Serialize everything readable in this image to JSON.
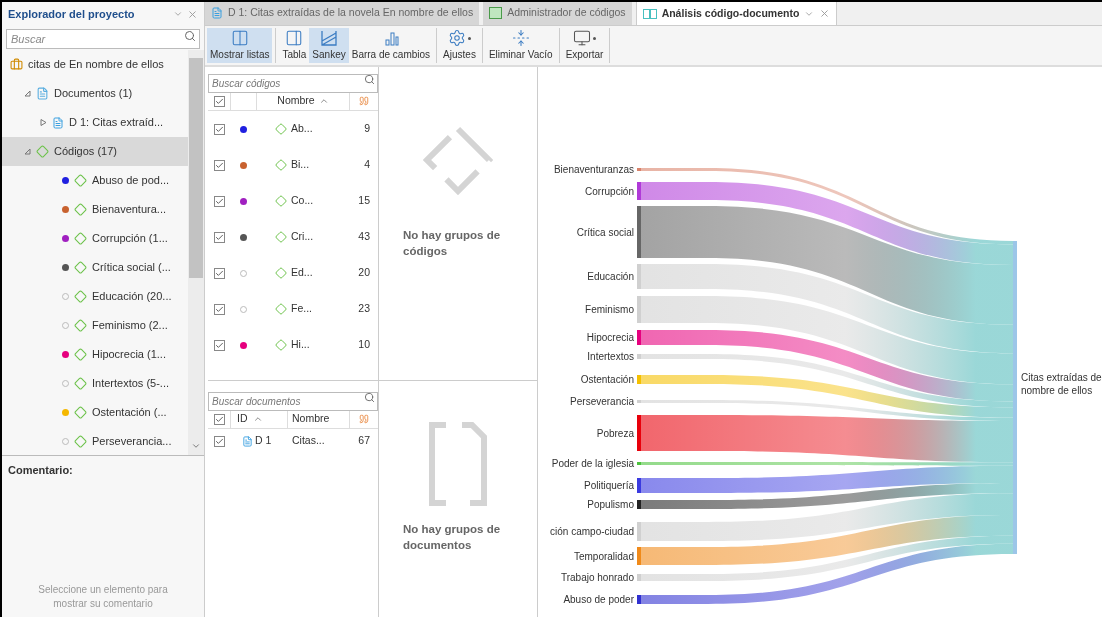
{
  "project_explorer": {
    "title": "Explorador del proyecto",
    "search": {
      "placeholder": "Buscar"
    },
    "tree": [
      {
        "label": "citas de En nombre de ellos",
        "kind": "project",
        "selected": false,
        "children": [
          {
            "label": "Documentos (1)",
            "kind": "documents",
            "expanded": true,
            "selected": false,
            "children": [
              {
                "label": "D 1: Citas extraíd...",
                "kind": "document",
                "expanded": false,
                "selected": false
              }
            ]
          },
          {
            "label": "Códigos (17)",
            "kind": "codes",
            "expanded": true,
            "selected": true,
            "children": [
              {
                "label": "Abuso de pod...",
                "kind": "code",
                "selected": false,
                "color": "#2020e0"
              },
              {
                "label": "Bienaventura...",
                "kind": "code",
                "selected": false,
                "color": "#c8622f"
              },
              {
                "label": "Corrupción (1...",
                "kind": "code",
                "selected": false,
                "color": "#a020c0"
              },
              {
                "label": "Crítica social (...",
                "kind": "code",
                "selected": false,
                "color": "#555555"
              },
              {
                "label": "Educación (20...",
                "kind": "code",
                "selected": false
              },
              {
                "label": "Feminismo (2...",
                "kind": "code",
                "selected": false
              },
              {
                "label": "Hipocrecia (1...",
                "kind": "code",
                "selected": false,
                "color": "#e6007e"
              },
              {
                "label": "Intertextos (5-...",
                "kind": "code",
                "selected": false
              },
              {
                "label": "Ostentación (...",
                "kind": "code",
                "selected": false,
                "color": "#f5b800"
              },
              {
                "label": "Perseverancia...",
                "kind": "code",
                "selected": false
              }
            ]
          }
        ]
      }
    ]
  },
  "comment": {
    "title": "Comentario:",
    "placeholder": "Seleccione un elemento para mostrar su comentario"
  },
  "tabs": [
    {
      "label": "D 1: Citas extraídas de la novela En nombre de ellos",
      "kind": "document",
      "selected": false
    },
    {
      "label": "Administrador de códigos",
      "kind": "code-manager",
      "selected": false
    },
    {
      "label": "Análisis código-documento",
      "kind": "analysis",
      "selected": true
    }
  ],
  "toolbar": {
    "groups": [
      [
        {
          "label": "Mostrar listas",
          "kind": "lists",
          "selected": true,
          "dropdown": false
        }
      ],
      [
        {
          "label": "Tabla",
          "kind": "table",
          "selected": false,
          "dropdown": false
        },
        {
          "label": "Sankey",
          "kind": "sankey",
          "selected": true,
          "dropdown": false
        },
        {
          "label": "Barra de cambios",
          "kind": "bars",
          "selected": false,
          "dropdown": false
        }
      ],
      [
        {
          "label": "Ajustes",
          "kind": "settings",
          "selected": false,
          "dropdown": true
        }
      ],
      [
        {
          "label": "Eliminar Vacío",
          "kind": "remove-empty",
          "selected": false,
          "dropdown": false
        }
      ],
      [
        {
          "label": "Exportar",
          "kind": "export",
          "selected": false,
          "dropdown": true
        }
      ]
    ]
  },
  "codes_list": {
    "search": {
      "placeholder": "Buscar códigos"
    },
    "header": {
      "checked": true,
      "name": "Nombre"
    },
    "rows": [
      {
        "checked": true,
        "color": "#2020e0",
        "name": "Ab...",
        "count": "9"
      },
      {
        "checked": true,
        "color": "#c8622f",
        "name": "Bi...",
        "count": "4"
      },
      {
        "checked": true,
        "color": "#a020c0",
        "name": "Co...",
        "count": "15"
      },
      {
        "checked": true,
        "color": "#555555",
        "name": "Cri...",
        "count": "43"
      },
      {
        "checked": true,
        "name": "Ed...",
        "count": "20"
      },
      {
        "checked": true,
        "name": "Fe...",
        "count": "23"
      },
      {
        "checked": true,
        "color": "#e6007e",
        "name": "Hi...",
        "count": "10"
      }
    ]
  },
  "documents_list": {
    "search": {
      "placeholder": "Buscar documentos"
    },
    "header": {
      "checked": true,
      "id": "ID",
      "name": "Nombre"
    },
    "rows": [
      {
        "checked": true,
        "id": "D 1",
        "name": "Citas...",
        "count": "67"
      }
    ]
  },
  "code_groups": {
    "message": "No hay grupos de códigos"
  },
  "document_groups": {
    "message": "No hay grupos de documentos"
  },
  "sankey": {
    "nodes": [
      {
        "label": "Bienaventuranzas",
        "color": "#d9826a"
      },
      {
        "label": "Corrupción",
        "color": "#b03ad8"
      },
      {
        "label": "Crítica social",
        "color": "#666666"
      },
      {
        "label": "Educación",
        "color": "#d0d0d0"
      },
      {
        "label": "Feminismo",
        "color": "#d0d0d0"
      },
      {
        "label": "Hipocrecia",
        "color": "#e6007e"
      },
      {
        "label": "Intertextos",
        "color": "#d0d0d0"
      },
      {
        "label": "Ostentación",
        "color": "#f5c000"
      },
      {
        "label": "Perseverancia",
        "color": "#d0d0d0"
      },
      {
        "label": "Pobreza",
        "color": "#e8000b"
      },
      {
        "label": "Poder de la iglesia",
        "color": "#4cc23c"
      },
      {
        "label": "Politiquería",
        "color": "#3a3ae0"
      },
      {
        "label": "Populismo",
        "color": "#222222"
      },
      {
        "label": "ción campo-ciudad",
        "color": "#d0d0d0"
      },
      {
        "label": "Temporalidad",
        "color": "#f08a1a"
      },
      {
        "label": "Trabajo honrado",
        "color": "#d0d0d0"
      },
      {
        "label": "Abuso de poder",
        "color": "#3030d0"
      }
    ],
    "target": {
      "label": "Citas extraídas de nombre de ellos"
    }
  }
}
